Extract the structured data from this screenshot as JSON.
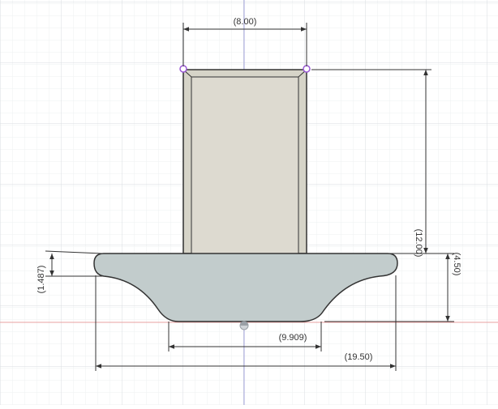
{
  "viewport": {
    "background": "#ffffff",
    "minor_grid_color": "#eef0f2",
    "major_grid_color": "#d9dde1",
    "x_axis_color": "#e8a0a0",
    "y_axis_color": "#a9a9e0"
  },
  "sketch": {
    "stem_fill": "#d6d4c8",
    "stem_inner_fill": "#dddad0",
    "base_fill": "#c2cccc",
    "outline_color": "#333333",
    "constraint_point_color": "#9b59d6",
    "origin_marker_color": "#9aa0a6"
  },
  "dimensions": {
    "top_width": "(8.00)",
    "stem_height": "(12.00)",
    "base_height": "(4.50)",
    "edge_height": "(1.487)",
    "bottom_width": "(9.909)",
    "overall_width": "(19.50)"
  }
}
